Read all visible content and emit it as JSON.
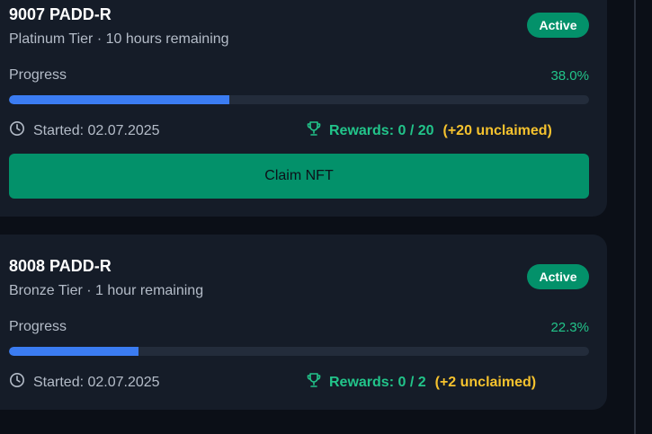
{
  "cards": [
    {
      "title": "9007 PADD-R",
      "subtitle": "Platinum Tier · 10 hours remaining",
      "status": "Active",
      "progress_label": "Progress",
      "progress_pct_text": "38.0%",
      "progress": 0.38,
      "started": "Started: 02.07.2025",
      "rewards": "Rewards: 0 / 20",
      "unclaimed": "(+20 unclaimed)",
      "claim_label": "Claim NFT"
    },
    {
      "title": "8008 PADD-R",
      "subtitle": "Bronze Tier · 1 hour remaining",
      "status": "Active",
      "progress_label": "Progress",
      "progress_pct_text": "22.3%",
      "progress": 0.223,
      "started": "Started: 02.07.2025",
      "rewards": "Rewards: 0 / 2",
      "unclaimed": "(+2 unclaimed)"
    }
  ],
  "icons": {
    "clock": "clock-icon",
    "trophy": "trophy-icon"
  },
  "colors": {
    "background": "#0b0f17",
    "card": "#151c28",
    "active_badge": "#03916a",
    "progress_fill": "#3b7cf2",
    "rewards": "#22c48a",
    "unclaimed": "#f5c22e"
  }
}
